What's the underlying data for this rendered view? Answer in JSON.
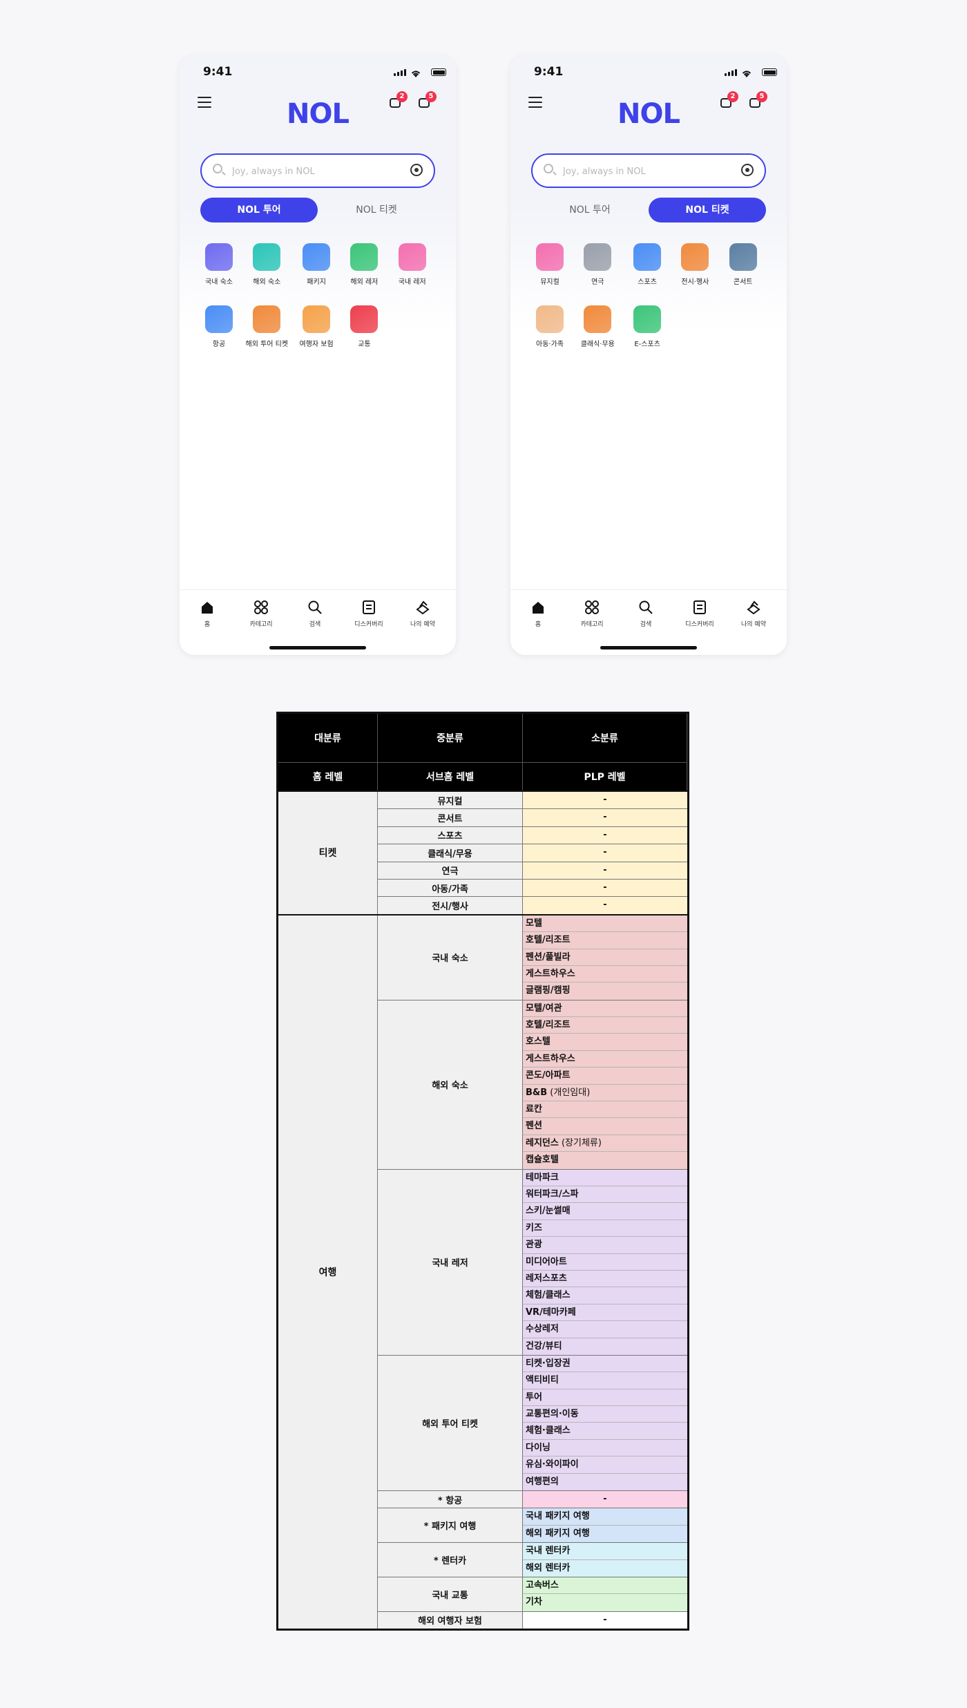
{
  "status": {
    "time": "9:41"
  },
  "phones": [
    {
      "logo": "NOL",
      "badges": {
        "chat": "2",
        "notify": "5"
      },
      "search_placeholder": "Joy, always in NOL",
      "tabs": [
        {
          "label": "NOL 투어",
          "active": true
        },
        {
          "label": "NOL 티켓",
          "active": false
        }
      ],
      "categories": [
        {
          "label": "국내 숙소",
          "icon": "building-icon",
          "color": "#6f6cf0"
        },
        {
          "label": "해외 숙소",
          "icon": "resort-icon",
          "color": "#2cc5b8"
        },
        {
          "label": "패키지",
          "icon": "suitcase-icon",
          "color": "#4a8ef5"
        },
        {
          "label": "해외 레저",
          "icon": "tent-icon",
          "color": "#3cc57a"
        },
        {
          "label": "국내 레저",
          "icon": "ferris-wheel-icon",
          "color": "#f46fb0"
        },
        {
          "label": "항공",
          "icon": "airplane-icon",
          "color": "#4a8ef5"
        },
        {
          "label": "해외 투어 티켓",
          "icon": "eiffel-tower-icon",
          "color": "#f08a3c"
        },
        {
          "label": "여행자 보험",
          "icon": "insurance-icon",
          "color": "#f5a24a"
        },
        {
          "label": "교통",
          "icon": "bus-icon",
          "color": "#ee3f4e"
        }
      ]
    },
    {
      "logo": "NOL",
      "badges": {
        "chat": "2",
        "notify": "5"
      },
      "search_placeholder": "Joy, always in NOL",
      "tabs": [
        {
          "label": "NOL 투어",
          "active": false
        },
        {
          "label": "NOL 티켓",
          "active": true
        }
      ],
      "categories": [
        {
          "label": "뮤지컬",
          "icon": "carousel-icon",
          "color": "#f46fb0"
        },
        {
          "label": "연극",
          "icon": "gorilla-icon",
          "color": "#9aa0aa"
        },
        {
          "label": "스포츠",
          "icon": "pool-icon",
          "color": "#4a8ef5"
        },
        {
          "label": "전시·행사",
          "icon": "painting-icon",
          "color": "#f08a3c"
        },
        {
          "label": "콘서트",
          "icon": "shark-icon",
          "color": "#5b7fa3"
        },
        {
          "label": "아동·가족",
          "icon": "family-icon",
          "color": "#f1b98a"
        },
        {
          "label": "클래식·무용",
          "icon": "tiger-icon",
          "color": "#f08a3c"
        },
        {
          "label": "E-스포츠",
          "icon": "cable-car-icon",
          "color": "#3cc57a"
        }
      ]
    }
  ],
  "bottom_nav": [
    {
      "label": "홈",
      "icon": "home-icon"
    },
    {
      "label": "카테고리",
      "icon": "category-icon"
    },
    {
      "label": "검색",
      "icon": "search-icon"
    },
    {
      "label": "디스커버리",
      "icon": "discovery-icon"
    },
    {
      "label": "나의 예약",
      "icon": "reservation-icon"
    }
  ],
  "table": {
    "headers": [
      "대분류",
      "중분류",
      "소분류"
    ],
    "subheaders": [
      "홈 레벨",
      "서브홈 레벨",
      "PLP 레벨"
    ],
    "sections": [
      {
        "major": "티켓",
        "mids": [
          {
            "name": "뮤지컬",
            "color": "#fff3cf",
            "subs": [
              "-"
            ]
          },
          {
            "name": "콘서트",
            "color": "#fff3cf",
            "subs": [
              "-"
            ]
          },
          {
            "name": "스포츠",
            "color": "#fff3cf",
            "subs": [
              "-"
            ]
          },
          {
            "name": "클래식/무용",
            "color": "#fff3cf",
            "subs": [
              "-"
            ]
          },
          {
            "name": "연극",
            "color": "#fff3cf",
            "subs": [
              "-"
            ]
          },
          {
            "name": "아동/가족",
            "color": "#fff3cf",
            "subs": [
              "-"
            ]
          },
          {
            "name": "전시/행사",
            "color": "#fff3cf",
            "subs": [
              "-"
            ]
          }
        ]
      },
      {
        "major": "여행",
        "mids": [
          {
            "name": "국내 숙소",
            "color": "#f1cdcd",
            "subs": [
              "모텔",
              "호텔/리조트",
              "펜션/풀빌라",
              "게스트하우스",
              "글램핑/캠핑"
            ]
          },
          {
            "name": "해외 숙소",
            "color": "#f1cdcd",
            "subs": [
              "모텔/여관",
              "호텔/리조트",
              "호스텔",
              "게스트하우스",
              "콘도/아파트",
              {
                "main": "B&B",
                "note": " (개인임대)"
              },
              "료칸",
              "펜션",
              {
                "main": "레지던스",
                "note": " (장기체류)"
              },
              "캡슐호텔"
            ]
          },
          {
            "name": "국내 레저",
            "color": "#e6d7f3",
            "subs": [
              "테마파크",
              "워터파크/스파",
              "스키/눈썰매",
              "키즈",
              "관광",
              "미디어아트",
              "레저스포츠",
              "체험/클래스",
              "VR/테마카페",
              "수상레저",
              "건강/뷰티"
            ]
          },
          {
            "name": "해외 투어 티켓",
            "color": "#e6d7f3",
            "subs": [
              "티켓·입장권",
              "액티비티",
              "투어",
              "교통편의·이동",
              "체험·클래스",
              "다이닝",
              "유심·와이파이",
              "여행편의"
            ]
          },
          {
            "name": "* 항공",
            "color": "#fbd3e6",
            "subs": [
              "-"
            ]
          },
          {
            "name": "* 패키지 여행",
            "color": "#d3e3f8",
            "subs": [
              "국내 패키지 여행",
              "해외 패키지 여행"
            ]
          },
          {
            "name": "* 렌터카",
            "color": "#d7f1f8",
            "subs": [
              "국내 렌터카",
              "해외 렌터카"
            ]
          },
          {
            "name": "국내 교통",
            "color": "#d9f5d6",
            "subs": [
              "고속버스",
              "기차"
            ]
          },
          {
            "name": "해외 여행자 보험",
            "color": "#ffffff",
            "subs": [
              "-"
            ]
          }
        ]
      }
    ]
  }
}
